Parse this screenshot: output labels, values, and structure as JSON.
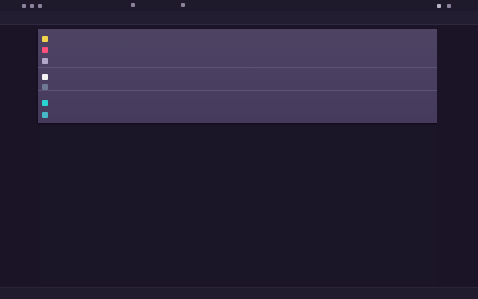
{
  "menubar": {
    "tabs": [
      "",
      "",
      "",
      ""
    ]
  },
  "panel": {
    "rows": [
      {
        "label": "",
        "icon_color": "#f2d34c"
      },
      {
        "label": "",
        "icon_color": "#ff4f7a"
      },
      {
        "label": "",
        "icon_color": "#b2a7c9"
      },
      {
        "label": "",
        "icon_color": "#f2f2f2"
      },
      {
        "label": "",
        "icon_color": "#6f7a92"
      },
      {
        "label": "",
        "icon_color": "#29d3cf"
      },
      {
        "label": "",
        "icon_color": "#47b7c8"
      }
    ]
  },
  "statusbar": {
    "items": [
      "",
      "",
      "",
      "",
      ""
    ]
  },
  "colors": {
    "background": "#1b1528",
    "panel": "#4a3f61",
    "accent": "#29d3cf"
  }
}
